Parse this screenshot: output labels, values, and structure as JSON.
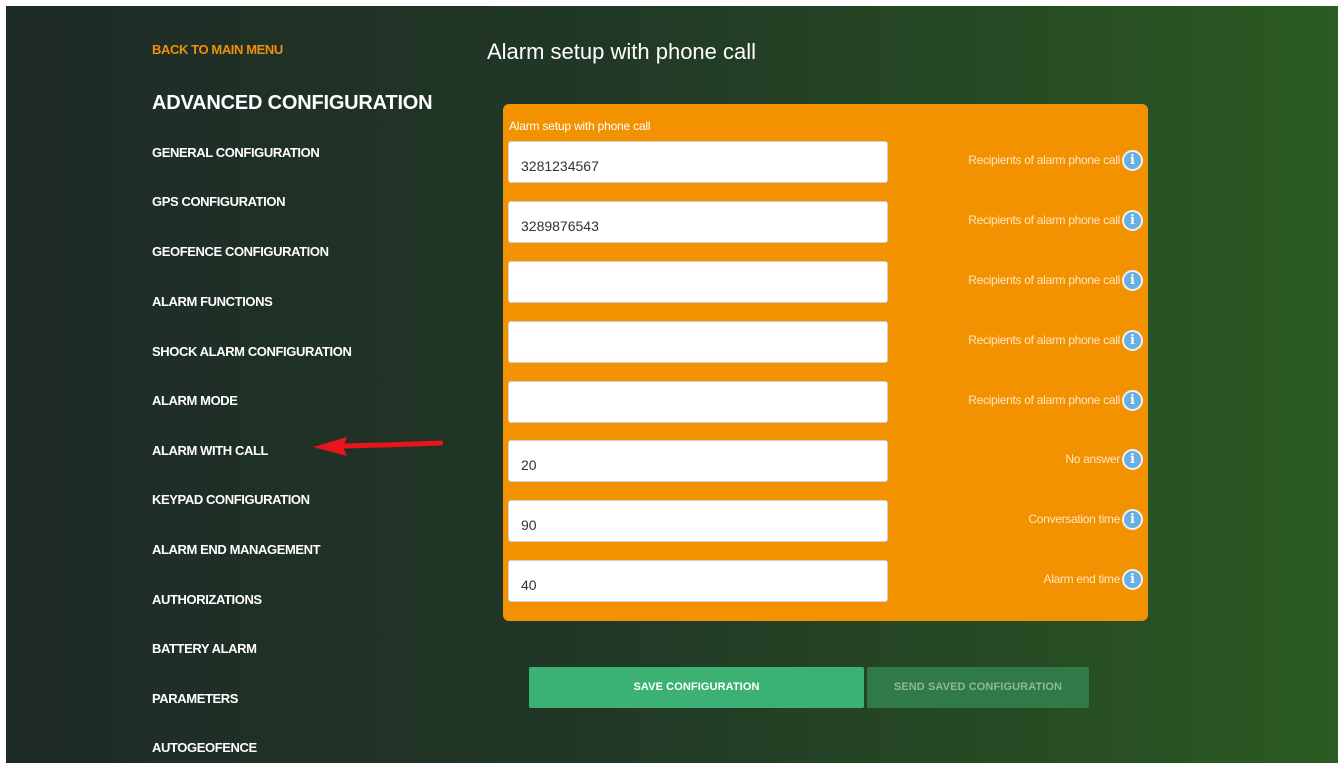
{
  "nav": {
    "back_label": "BACK TO MAIN MENU",
    "section_title": "ADVANCED CONFIGURATION",
    "items": [
      "GENERAL CONFIGURATION",
      "GPS CONFIGURATION",
      "GEOFENCE CONFIGURATION",
      "ALARM FUNCTIONS",
      "SHOCK ALARM CONFIGURATION",
      "ALARM MODE",
      "ALARM WITH CALL",
      "KEYPAD CONFIGURATION",
      "ALARM END MANAGEMENT",
      "AUTHORIZATIONS",
      "BATTERY ALARM",
      "PARAMETERS",
      "AUTOGEOFENCE"
    ],
    "highlighted_item": "ALARM WITH CALL"
  },
  "page": {
    "title": "Alarm setup with phone call"
  },
  "form": {
    "panel_label": "Alarm setup with phone call",
    "fields": [
      {
        "value": "3281234567",
        "hint": "Recipients of alarm phone call",
        "icon": "info-icon"
      },
      {
        "value": "3289876543",
        "hint": "Recipients of alarm phone call",
        "icon": "info-icon"
      },
      {
        "value": "",
        "hint": "Recipients of alarm phone call",
        "icon": "info-icon"
      },
      {
        "value": "",
        "hint": "Recipients of alarm phone call",
        "icon": "info-icon"
      },
      {
        "value": "",
        "hint": "Recipients of alarm phone call",
        "icon": "info-icon"
      },
      {
        "value": "20",
        "hint": "No answer",
        "icon": "info-icon"
      },
      {
        "value": "90",
        "hint": "Conversation time",
        "icon": "info-icon"
      },
      {
        "value": "40",
        "hint": "Alarm end time",
        "icon": "info-icon"
      }
    ]
  },
  "actions": {
    "save_label": "SAVE CONFIGURATION",
    "send_label": "SEND SAVED CONFIGURATION",
    "send_enabled": false
  },
  "colors": {
    "accent": "#f39200",
    "back_link": "#f0900a",
    "save_button": "#3bb273",
    "send_button": "#2f7a46",
    "annotation_arrow": "#e8141e"
  }
}
